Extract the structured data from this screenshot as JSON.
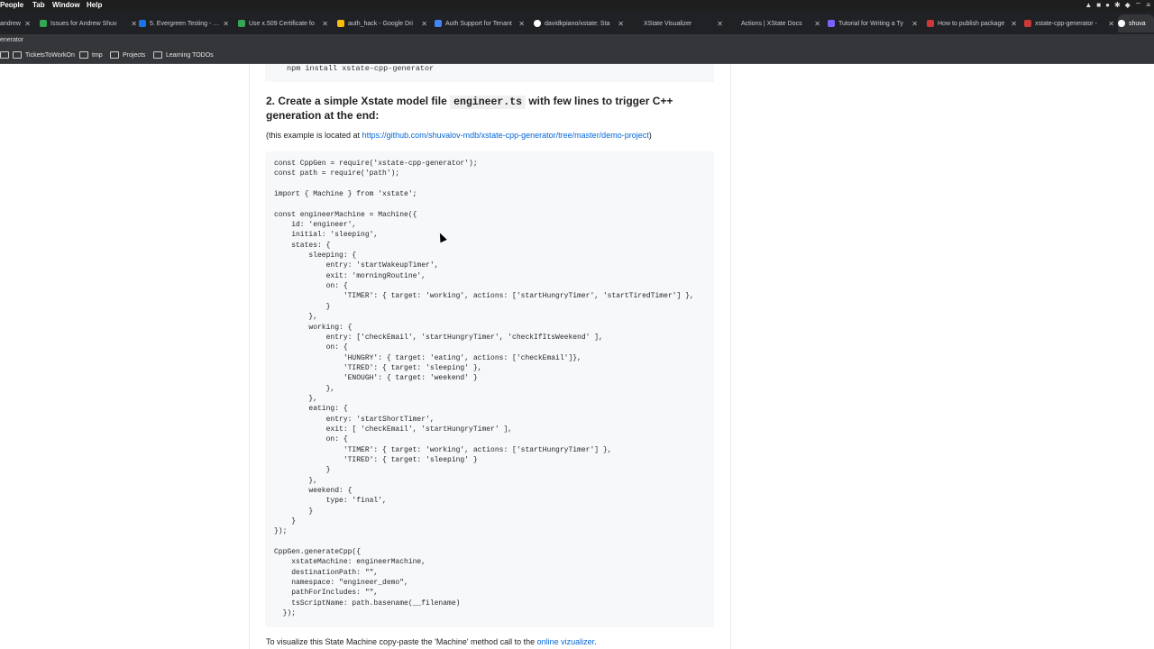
{
  "menubar": {
    "items": [
      "People",
      "Tab",
      "Window",
      "Help"
    ]
  },
  "tabs": [
    {
      "title": "andrew",
      "color": "#888888"
    },
    {
      "title": "Issues for Andrew Shuv",
      "color": "#34a853"
    },
    {
      "title": "5. Evergreen Testing - …",
      "color": "#1a73e8"
    },
    {
      "title": "Use x.509 Certificate fo",
      "color": "#34a853"
    },
    {
      "title": "auth_hack - Google Dri",
      "color": "#fbbc04"
    },
    {
      "title": "Auth Support for Tenant",
      "color": "#4285f4"
    },
    {
      "title": "davidkpiano/xstate: Sta",
      "color": "#ffffff"
    },
    {
      "title": "XState Visualizer",
      "color": "#222222"
    },
    {
      "title": "Actions | XState Docs",
      "color": "#222222"
    },
    {
      "title": "Tutorial for Writing a Ty",
      "color": "#7b61ff"
    },
    {
      "title": "How to publish package",
      "color": "#cb3837"
    },
    {
      "title": "xstate-cpp-generator -",
      "color": "#cb3837"
    },
    {
      "title": "shuva",
      "color": "#ffffff"
    }
  ],
  "address": {
    "text": "enerator"
  },
  "bookmarks": [
    "TicketsToWorkOn",
    "tmp",
    "Projects",
    "Learning TODOs"
  ],
  "content": {
    "install_cmd": "npm install xstate-cpp-generator",
    "heading_pre": "2. Create a simple Xstate model file ",
    "heading_code": "engineer.ts",
    "heading_post": " with few lines to trigger C++ generation at the end:",
    "note_pre": "(this example is located at ",
    "note_link": "https://github.com/shuvalov-mdb/xstate-cpp-generator/tree/master/demo-project",
    "note_post": ")",
    "code": "const CppGen = require('xstate-cpp-generator');\nconst path = require('path');\n\nimport { Machine } from 'xstate';\n\nconst engineerMachine = Machine({\n    id: 'engineer',\n    initial: 'sleeping',\n    states: {\n        sleeping: {\n            entry: 'startWakeupTimer',\n            exit: 'morningRoutine',\n            on: {\n                'TIMER': { target: 'working', actions: ['startHungryTimer', 'startTiredTimer'] },\n            }\n        },\n        working: {\n            entry: ['checkEmail', 'startHungryTimer', 'checkIfItsWeekend' ],\n            on: {\n                'HUNGRY': { target: 'eating', actions: ['checkEmail']},\n                'TIRED': { target: 'sleeping' },\n                'ENOUGH': { target: 'weekend' }\n            },\n        },\n        eating: {\n            entry: 'startShortTimer',\n            exit: [ 'checkEmail', 'startHungryTimer' ],\n            on: {\n                'TIMER': { target: 'working', actions: ['startHungryTimer'] },\n                'TIRED': { target: 'sleeping' }\n            }\n        },\n        weekend: {\n            type: 'final',\n        }\n    }\n});\n\nCppGen.generateCpp({\n    xstateMachine: engineerMachine,\n    destinationPath: \"\",\n    namespace: \"engineer_demo\",\n    pathForIncludes: \"\",\n    tsScriptName: path.basename(__filename)\n  });",
    "foot_pre": "To visualize this State Machine copy-paste the 'Machine' method call to the ",
    "foot_link": "online vizualizer",
    "foot_post": "."
  }
}
